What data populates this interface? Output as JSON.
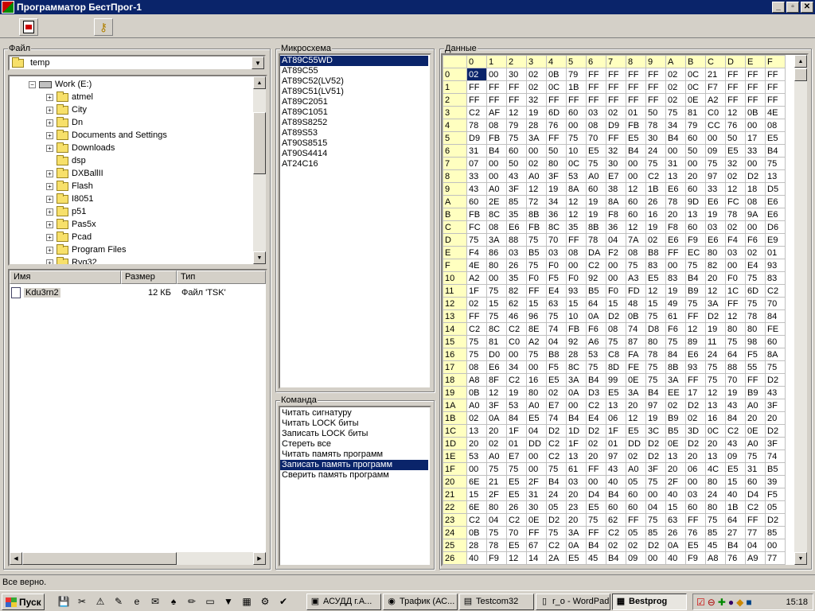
{
  "window": {
    "title": "Программатор БестПрог-1",
    "min": "_",
    "max": "▫",
    "close": "✕"
  },
  "toolbar": {
    "btn1_icon": "chip-write-icon",
    "btn2_icon": "key-icon"
  },
  "file_panel": {
    "label": "Файл",
    "combo_value": "temp",
    "tree": [
      {
        "name": "Work (E:)",
        "level": 0,
        "expand": "−",
        "type": "drive"
      },
      {
        "name": "atmel",
        "level": 1,
        "expand": "+"
      },
      {
        "name": "City",
        "level": 1,
        "expand": "+"
      },
      {
        "name": "Dn",
        "level": 1,
        "expand": "+"
      },
      {
        "name": "Documents and Settings",
        "level": 1,
        "expand": "+"
      },
      {
        "name": "Downloads",
        "level": 1,
        "expand": "+"
      },
      {
        "name": "dsp",
        "level": 1,
        "expand": ""
      },
      {
        "name": "DXBallII",
        "level": 1,
        "expand": "+"
      },
      {
        "name": "Flash",
        "level": 1,
        "expand": "+"
      },
      {
        "name": "I8051",
        "level": 1,
        "expand": "+"
      },
      {
        "name": "p51",
        "level": 1,
        "expand": "+"
      },
      {
        "name": "Pas5x",
        "level": 1,
        "expand": "+"
      },
      {
        "name": "Pcad",
        "level": 1,
        "expand": "+"
      },
      {
        "name": "Program Files",
        "level": 1,
        "expand": "+"
      },
      {
        "name": "Rvg32",
        "level": 1,
        "expand": "+"
      }
    ],
    "list_headers": [
      "Имя",
      "Размер",
      "Тип"
    ],
    "files": [
      {
        "name": "Kdu3rn2",
        "size": "12 КБ",
        "type": "Файл 'TSK'"
      }
    ]
  },
  "chip_panel": {
    "label": "Микросхема",
    "items": [
      "AT89C55WD",
      "AT89C55",
      "AT89C52(LV52)",
      "AT89C51(LV51)",
      "AT89C2051",
      "AT89C1051",
      "AT89S8252",
      "AT89S53",
      "AT90S8515",
      "AT90S4414",
      "AT24C16"
    ],
    "selected": 0
  },
  "command_panel": {
    "label": "Команда",
    "items": [
      "Читать сигнатуру",
      "Читать LOCK биты",
      "Записать LOCK биты",
      "Стереть все",
      "Читать память программ",
      "Записать память программ",
      "Сверить память программ"
    ],
    "selected": 5
  },
  "data_panel": {
    "label": "Данные",
    "col_headers": [
      "0",
      "1",
      "2",
      "3",
      "4",
      "5",
      "6",
      "7",
      "8",
      "9",
      "A",
      "B",
      "C",
      "D",
      "E",
      "F"
    ],
    "rows": [
      {
        "addr": "0",
        "bytes": [
          "02",
          "00",
          "30",
          "02",
          "0B",
          "79",
          "FF",
          "FF",
          "FF",
          "FF",
          "02",
          "0C",
          "21",
          "FF",
          "FF",
          "FF"
        ]
      },
      {
        "addr": "1",
        "bytes": [
          "FF",
          "FF",
          "FF",
          "02",
          "0C",
          "1B",
          "FF",
          "FF",
          "FF",
          "FF",
          "02",
          "0C",
          "F7",
          "FF",
          "FF",
          "FF"
        ]
      },
      {
        "addr": "2",
        "bytes": [
          "FF",
          "FF",
          "FF",
          "32",
          "FF",
          "FF",
          "FF",
          "FF",
          "FF",
          "FF",
          "02",
          "0E",
          "A2",
          "FF",
          "FF",
          "FF"
        ]
      },
      {
        "addr": "3",
        "bytes": [
          "C2",
          "AF",
          "12",
          "19",
          "6D",
          "60",
          "03",
          "02",
          "01",
          "50",
          "75",
          "81",
          "C0",
          "12",
          "0B",
          "4E"
        ]
      },
      {
        "addr": "4",
        "bytes": [
          "78",
          "08",
          "79",
          "28",
          "76",
          "00",
          "08",
          "D9",
          "FB",
          "78",
          "34",
          "79",
          "CC",
          "76",
          "00",
          "08"
        ]
      },
      {
        "addr": "5",
        "bytes": [
          "D9",
          "FB",
          "75",
          "3A",
          "FF",
          "75",
          "70",
          "FF",
          "E5",
          "30",
          "B4",
          "60",
          "00",
          "50",
          "17",
          "E5"
        ]
      },
      {
        "addr": "6",
        "bytes": [
          "31",
          "B4",
          "60",
          "00",
          "50",
          "10",
          "E5",
          "32",
          "B4",
          "24",
          "00",
          "50",
          "09",
          "E5",
          "33",
          "B4"
        ]
      },
      {
        "addr": "7",
        "bytes": [
          "07",
          "00",
          "50",
          "02",
          "80",
          "0C",
          "75",
          "30",
          "00",
          "75",
          "31",
          "00",
          "75",
          "32",
          "00",
          "75"
        ]
      },
      {
        "addr": "8",
        "bytes": [
          "33",
          "00",
          "43",
          "A0",
          "3F",
          "53",
          "A0",
          "E7",
          "00",
          "C2",
          "13",
          "20",
          "97",
          "02",
          "D2",
          "13"
        ]
      },
      {
        "addr": "9",
        "bytes": [
          "43",
          "A0",
          "3F",
          "12",
          "19",
          "8A",
          "60",
          "38",
          "12",
          "1B",
          "E6",
          "60",
          "33",
          "12",
          "18",
          "D5"
        ]
      },
      {
        "addr": "A",
        "bytes": [
          "60",
          "2E",
          "85",
          "72",
          "34",
          "12",
          "19",
          "8A",
          "60",
          "26",
          "78",
          "9D",
          "E6",
          "FC",
          "08",
          "E6"
        ]
      },
      {
        "addr": "B",
        "bytes": [
          "FB",
          "8C",
          "35",
          "8B",
          "36",
          "12",
          "19",
          "F8",
          "60",
          "16",
          "20",
          "13",
          "19",
          "78",
          "9A",
          "E6"
        ]
      },
      {
        "addr": "C",
        "bytes": [
          "FC",
          "08",
          "E6",
          "FB",
          "8C",
          "35",
          "8B",
          "36",
          "12",
          "19",
          "F8",
          "60",
          "03",
          "02",
          "00",
          "D6"
        ]
      },
      {
        "addr": "D",
        "bytes": [
          "75",
          "3A",
          "88",
          "75",
          "70",
          "FF",
          "78",
          "04",
          "7A",
          "02",
          "E6",
          "F9",
          "E6",
          "F4",
          "F6",
          "E9"
        ]
      },
      {
        "addr": "E",
        "bytes": [
          "F4",
          "86",
          "03",
          "B5",
          "03",
          "08",
          "DA",
          "F2",
          "08",
          "B8",
          "FF",
          "EC",
          "80",
          "03",
          "02",
          "01"
        ]
      },
      {
        "addr": "F",
        "bytes": [
          "4E",
          "80",
          "26",
          "75",
          "F0",
          "00",
          "C2",
          "00",
          "75",
          "83",
          "00",
          "75",
          "82",
          "00",
          "E4",
          "93"
        ]
      },
      {
        "addr": "10",
        "bytes": [
          "A2",
          "00",
          "35",
          "F0",
          "F5",
          "F0",
          "92",
          "00",
          "A3",
          "E5",
          "83",
          "B4",
          "20",
          "F0",
          "75",
          "83"
        ]
      },
      {
        "addr": "11",
        "bytes": [
          "1F",
          "75",
          "82",
          "FF",
          "E4",
          "93",
          "B5",
          "F0",
          "FD",
          "12",
          "19",
          "B9",
          "12",
          "1C",
          "6D",
          "C2"
        ]
      },
      {
        "addr": "12",
        "bytes": [
          "02",
          "15",
          "62",
          "15",
          "63",
          "15",
          "64",
          "15",
          "48",
          "15",
          "49",
          "75",
          "3A",
          "FF",
          "75",
          "70"
        ]
      },
      {
        "addr": "13",
        "bytes": [
          "FF",
          "75",
          "46",
          "96",
          "75",
          "10",
          "0A",
          "D2",
          "0B",
          "75",
          "61",
          "FF",
          "D2",
          "12",
          "78",
          "84"
        ]
      },
      {
        "addr": "14",
        "bytes": [
          "C2",
          "8C",
          "C2",
          "8E",
          "74",
          "FB",
          "F6",
          "08",
          "74",
          "D8",
          "F6",
          "12",
          "19",
          "80",
          "80",
          "FE"
        ]
      },
      {
        "addr": "15",
        "bytes": [
          "75",
          "81",
          "C0",
          "A2",
          "04",
          "92",
          "A6",
          "75",
          "87",
          "80",
          "75",
          "89",
          "11",
          "75",
          "98",
          "60"
        ]
      },
      {
        "addr": "16",
        "bytes": [
          "75",
          "D0",
          "00",
          "75",
          "B8",
          "28",
          "53",
          "C8",
          "FA",
          "78",
          "84",
          "E6",
          "24",
          "64",
          "F5",
          "8A"
        ]
      },
      {
        "addr": "17",
        "bytes": [
          "08",
          "E6",
          "34",
          "00",
          "F5",
          "8C",
          "75",
          "8D",
          "FE",
          "75",
          "8B",
          "93",
          "75",
          "88",
          "55",
          "75"
        ]
      },
      {
        "addr": "18",
        "bytes": [
          "A8",
          "8F",
          "C2",
          "16",
          "E5",
          "3A",
          "B4",
          "99",
          "0E",
          "75",
          "3A",
          "FF",
          "75",
          "70",
          "FF",
          "D2"
        ]
      },
      {
        "addr": "19",
        "bytes": [
          "0B",
          "12",
          "19",
          "80",
          "02",
          "0A",
          "D3",
          "E5",
          "3A",
          "B4",
          "EE",
          "17",
          "12",
          "19",
          "B9",
          "43"
        ]
      },
      {
        "addr": "1A",
        "bytes": [
          "A0",
          "3F",
          "53",
          "A0",
          "E7",
          "00",
          "C2",
          "13",
          "20",
          "97",
          "02",
          "D2",
          "13",
          "43",
          "A0",
          "3F"
        ]
      },
      {
        "addr": "1B",
        "bytes": [
          "02",
          "0A",
          "84",
          "E5",
          "74",
          "B4",
          "E4",
          "06",
          "12",
          "19",
          "B9",
          "02",
          "16",
          "84",
          "20",
          "20"
        ]
      },
      {
        "addr": "1C",
        "bytes": [
          "13",
          "20",
          "1F",
          "04",
          "D2",
          "1D",
          "D2",
          "1F",
          "E5",
          "3C",
          "B5",
          "3D",
          "0C",
          "C2",
          "0E",
          "D2"
        ]
      },
      {
        "addr": "1D",
        "bytes": [
          "20",
          "02",
          "01",
          "DD",
          "C2",
          "1F",
          "02",
          "01",
          "DD",
          "D2",
          "0E",
          "D2",
          "20",
          "43",
          "A0",
          "3F"
        ]
      },
      {
        "addr": "1E",
        "bytes": [
          "53",
          "A0",
          "E7",
          "00",
          "C2",
          "13",
          "20",
          "97",
          "02",
          "D2",
          "13",
          "20",
          "13",
          "09",
          "75",
          "74"
        ]
      },
      {
        "addr": "1F",
        "bytes": [
          "00",
          "75",
          "75",
          "00",
          "75",
          "61",
          "FF",
          "43",
          "A0",
          "3F",
          "20",
          "06",
          "4C",
          "E5",
          "31",
          "B5"
        ]
      },
      {
        "addr": "20",
        "bytes": [
          "6E",
          "21",
          "E5",
          "2F",
          "B4",
          "03",
          "00",
          "40",
          "05",
          "75",
          "2F",
          "00",
          "80",
          "15",
          "60",
          "39"
        ]
      },
      {
        "addr": "21",
        "bytes": [
          "15",
          "2F",
          "E5",
          "31",
          "24",
          "20",
          "D4",
          "B4",
          "60",
          "00",
          "40",
          "03",
          "24",
          "40",
          "D4",
          "F5"
        ]
      },
      {
        "addr": "22",
        "bytes": [
          "6E",
          "80",
          "26",
          "30",
          "05",
          "23",
          "E5",
          "60",
          "60",
          "04",
          "15",
          "60",
          "80",
          "1B",
          "C2",
          "05"
        ]
      },
      {
        "addr": "23",
        "bytes": [
          "C2",
          "04",
          "C2",
          "0E",
          "D2",
          "20",
          "75",
          "62",
          "FF",
          "75",
          "63",
          "FF",
          "75",
          "64",
          "FF",
          "D2"
        ]
      },
      {
        "addr": "24",
        "bytes": [
          "0B",
          "75",
          "70",
          "FF",
          "75",
          "3A",
          "FF",
          "C2",
          "05",
          "85",
          "26",
          "76",
          "85",
          "27",
          "77",
          "85"
        ]
      },
      {
        "addr": "25",
        "bytes": [
          "28",
          "78",
          "E5",
          "67",
          "C2",
          "0A",
          "B4",
          "02",
          "02",
          "D2",
          "0A",
          "E5",
          "45",
          "B4",
          "04",
          "00"
        ]
      },
      {
        "addr": "26",
        "bytes": [
          "40",
          "F9",
          "12",
          "14",
          "2A",
          "E5",
          "45",
          "B4",
          "09",
          "00",
          "40",
          "F9",
          "A8",
          "76",
          "A9",
          "77"
        ]
      }
    ]
  },
  "status": "Все верно.",
  "taskbar": {
    "start": "Пуск",
    "quick_icons": [
      "save-icon",
      "scissors-icon",
      "warning-icon",
      "edit-icon",
      "ie-icon",
      "outlook-icon",
      "cards-icon",
      "paint-icon",
      "monitor-icon",
      "filter-icon",
      "calc-icon",
      "gear-icon",
      "check-icon"
    ],
    "tasks": [
      {
        "label": "АСУДД г.А...",
        "icon": "app-icon"
      },
      {
        "label": "Трафик (АС...",
        "icon": "globe-icon"
      },
      {
        "label": "Testcom32",
        "icon": "terminal-icon"
      },
      {
        "label": "r_o - WordPad",
        "icon": "document-icon"
      },
      {
        "label": "Bestprog",
        "icon": "chip-icon",
        "active": true
      }
    ],
    "clock": "15:18"
  }
}
